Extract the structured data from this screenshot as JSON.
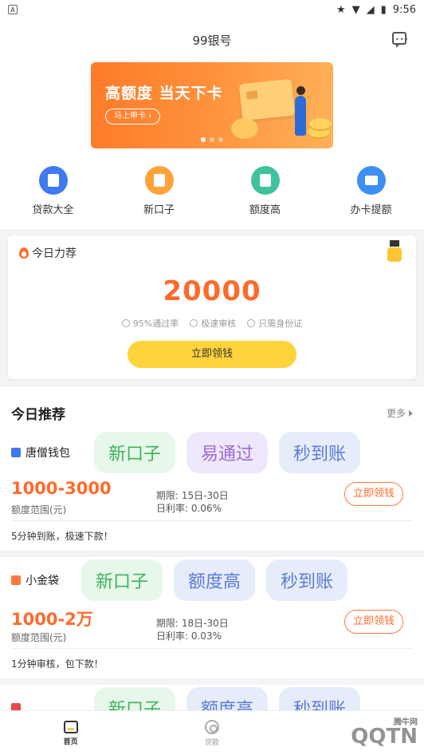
{
  "status_bar": {
    "time": "9:56",
    "app_glyph": "A"
  },
  "header": {
    "title": "99银号"
  },
  "banner": {
    "title": "高额度 当天下卡",
    "button": "马上申卡 ›"
  },
  "categories": [
    {
      "label": "贷款大全",
      "color": "#3f7af0"
    },
    {
      "label": "新口子",
      "color": "#ffa23a"
    },
    {
      "label": "额度高",
      "color": "#3fc29e"
    },
    {
      "label": "办卡提额",
      "color": "#3d8ef5"
    }
  ],
  "featured": {
    "heading": "今日力荐",
    "amount": "20000",
    "features": [
      "95%通过率",
      "极速审核",
      "只需身份证"
    ],
    "button": "立即领钱"
  },
  "recommend": {
    "title": "今日推荐",
    "more": "更多",
    "items": [
      {
        "name": "唐僧钱包",
        "tags": [
          "新口子",
          "易通过",
          "秒到账"
        ],
        "range": "1000-3000",
        "range_label": "额度范围(元)",
        "term": "期限: 15日-30日",
        "rate": "日利率: 0.06%",
        "apply": "立即领钱",
        "note": "5分钟到账，极速下款！",
        "icon_color": "#3d7af0"
      },
      {
        "name": "小金袋",
        "tags": [
          "新口子",
          "额度高",
          "秒到账"
        ],
        "range": "1000-2万",
        "range_label": "额度范围(元)",
        "term": "期限: 18日-30日",
        "rate": "日利率: 0.03%",
        "apply": "立即领钱",
        "note": "1分钟审核，包下款！",
        "icon_color": "#ff7a3a"
      },
      {
        "name": "",
        "tags": [
          "新口子",
          "额度高",
          "秒到账"
        ],
        "icon_color": "#e84a4a"
      }
    ]
  },
  "bottom_nav": [
    {
      "label": "首页",
      "active": true
    },
    {
      "label": "贷款",
      "active": false
    }
  ],
  "watermark": {
    "text": "QQTN",
    "sub": "腾牛网"
  }
}
